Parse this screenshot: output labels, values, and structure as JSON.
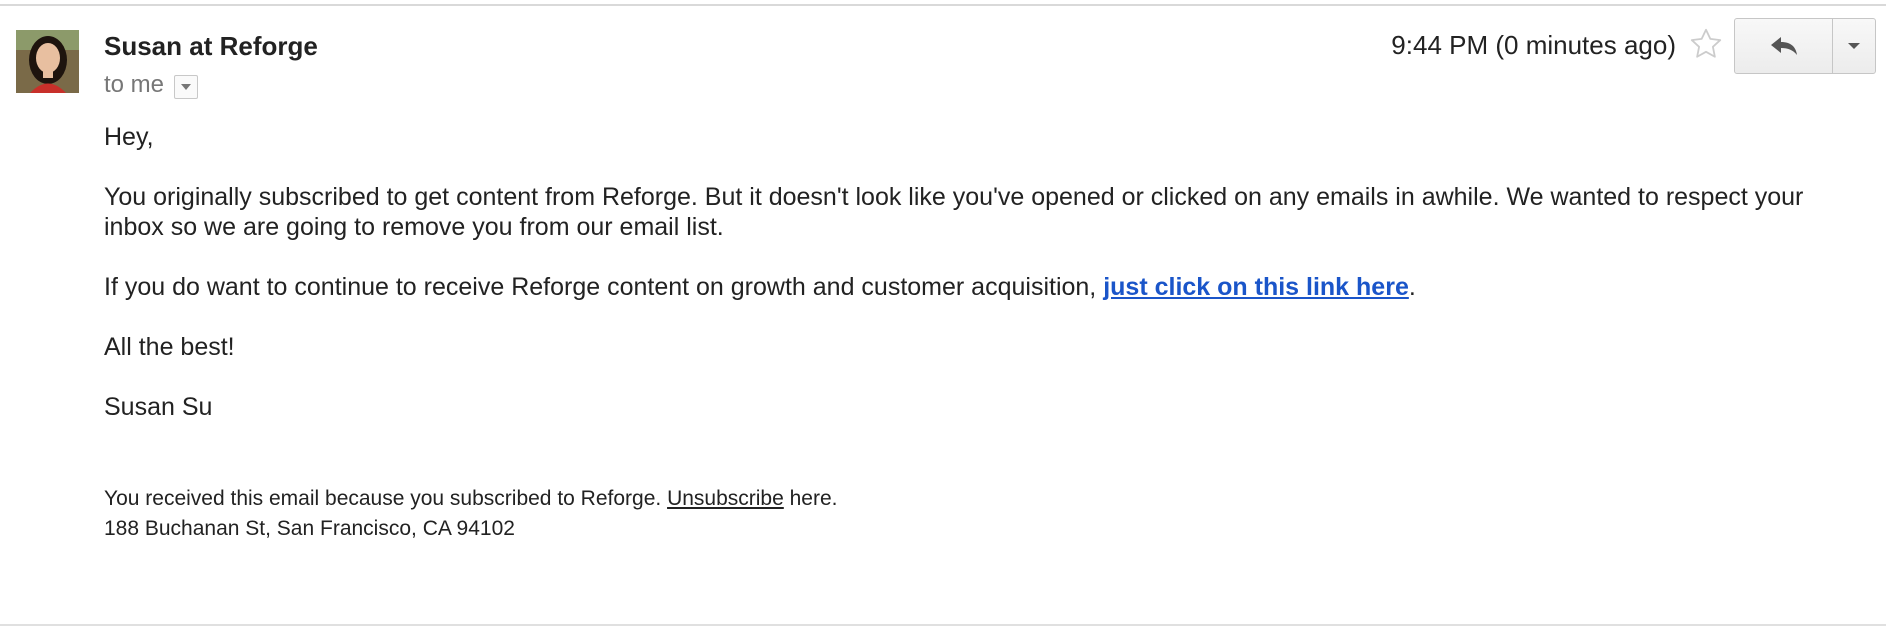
{
  "sender": {
    "name": "Susan at Reforge",
    "to_label": "to me"
  },
  "meta": {
    "timestamp": "9:44 PM (0 minutes ago)"
  },
  "icons": {
    "avatar": "sender-avatar-photo",
    "details": "chevron-down-icon",
    "star": "star-outline-icon",
    "reply": "reply-arrow-icon",
    "more": "caret-down-icon"
  },
  "body": {
    "greeting": "Hey,",
    "paragraph_1": "You originally subscribed to get content from Reforge.  But it doesn't look like you've opened or clicked on any emails in awhile.  We wanted to respect your inbox so we are going to remove you from our email list.",
    "paragraph_2_prefix": "If you do want to continue to receive Reforge content on growth and customer acquisition, ",
    "paragraph_2_link": "just click on this link here",
    "paragraph_2_suffix": ".",
    "closing": "All the best!",
    "signature": "Susan Su"
  },
  "footer": {
    "prefix": "You received this email because you subscribed to Reforge.  ",
    "unsubscribe_label": "Unsubscribe",
    "suffix": " here.",
    "address": "188 Buchanan St, San Francisco, CA 94102"
  },
  "colors": {
    "link": "#1a55c9",
    "text": "#222222",
    "muted": "#777777"
  }
}
